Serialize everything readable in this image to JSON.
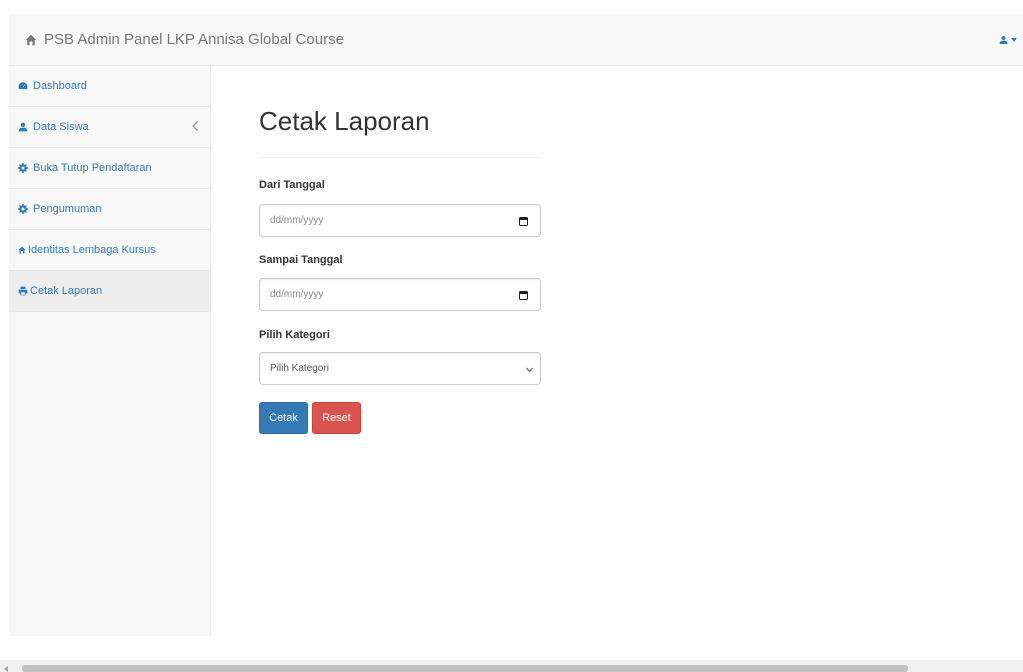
{
  "navbar": {
    "brand": "PSB Admin Panel LKP Annisa Global Course",
    "brand_icon": "home-icon",
    "user_icon": "user-icon"
  },
  "sidebar": {
    "items": [
      {
        "label": "Dashboard",
        "icon": "dashboard-icon"
      },
      {
        "label": "Data Siswa",
        "icon": "user-icon",
        "has_submenu": true
      },
      {
        "label": "Buka Tutup Pendaftaran",
        "icon": "gear-icon"
      },
      {
        "label": "Pengumuman",
        "icon": "gear-icon"
      },
      {
        "label": "Identitas Lembaga Kursus",
        "icon": "home-icon"
      },
      {
        "label": "Cetak Laporan",
        "icon": "print-icon",
        "active": true
      }
    ]
  },
  "main": {
    "title": "Cetak Laporan",
    "dari_label": "Dari Tanggal",
    "dari_placeholder": "dd/mm/yyyy",
    "sampai_label": "Sampai Tanggal",
    "sampai_placeholder": "dd/mm/yyyy",
    "kategori_label": "Pilih Kategori",
    "kategori_selected": "Pilih Kategori",
    "cetak_label": "Cetak",
    "reset_label": "Reset"
  },
  "colors": {
    "primary": "#337ab7",
    "danger": "#d9534f",
    "navbar_bg": "#f8f8f8"
  }
}
